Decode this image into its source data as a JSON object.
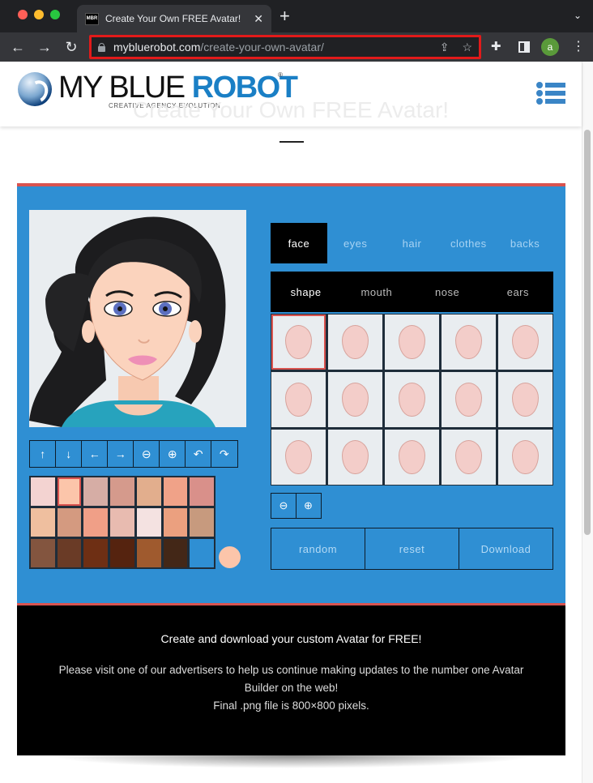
{
  "browser": {
    "tab_title": "Create Your Own FREE Avatar!",
    "favicon_text": "MBR",
    "url_host": "mybluerobot.com",
    "url_path": "/create-your-own-avatar/",
    "profile_initial": "a"
  },
  "header": {
    "logo_part1": "MY BLUE ",
    "logo_part2": "ROBOT",
    "logo_reg": "®",
    "tagline": "CREATIVE AGENCY EVOLUTION",
    "page_title": "Create Your Own FREE Avatar!"
  },
  "builder": {
    "tools": [
      {
        "name": "move-up",
        "glyph": "↑"
      },
      {
        "name": "move-down",
        "glyph": "↓"
      },
      {
        "name": "move-left",
        "glyph": "←"
      },
      {
        "name": "move-right",
        "glyph": "→"
      },
      {
        "name": "zoom-out",
        "glyph": "⊖"
      },
      {
        "name": "zoom-in",
        "glyph": "⊕"
      },
      {
        "name": "undo",
        "glyph": "↶"
      },
      {
        "name": "redo",
        "glyph": "↷"
      }
    ],
    "swatches": [
      "#f3d3d1",
      "#fcc5aa",
      "#d6ada5",
      "#d59a8c",
      "#e2ae8d",
      "#f0a288",
      "#d9908a",
      "#efbf9f",
      "#d49a80",
      "#f09f87",
      "#e8bbb0",
      "#f4e2e1",
      "#eba07f",
      "#c79a7e",
      "#83553f",
      "#6a3b26",
      "#6e2f14",
      "#55230f",
      "#9f5a2e",
      "#432717"
    ],
    "selected_swatch_index": 1,
    "current_color": "#fcc5aa",
    "categories": [
      "face",
      "eyes",
      "hair",
      "clothes",
      "backs"
    ],
    "active_category": "face",
    "subcategories": [
      "shape",
      "mouth",
      "nose",
      "ears"
    ],
    "active_subcategory": "shape",
    "shape_count": 15,
    "selected_shape_index": 0,
    "zoom_buttons": [
      {
        "name": "zoom-out",
        "glyph": "⊖"
      },
      {
        "name": "zoom-in",
        "glyph": "⊕"
      }
    ],
    "actions": {
      "random": "random",
      "reset": "reset",
      "download": "Download"
    }
  },
  "info": {
    "heading": "Create and download your custom Avatar for FREE!",
    "line1": "Please visit one of our advertisers to help us continue making updates to the number one Avatar Builder on the web!",
    "line2": "Final .png file is 800×800 pixels."
  },
  "colors": {
    "accent_blue": "#2f8fd3",
    "accent_red": "#d9534f",
    "brand_blue": "#1a7fc5"
  }
}
